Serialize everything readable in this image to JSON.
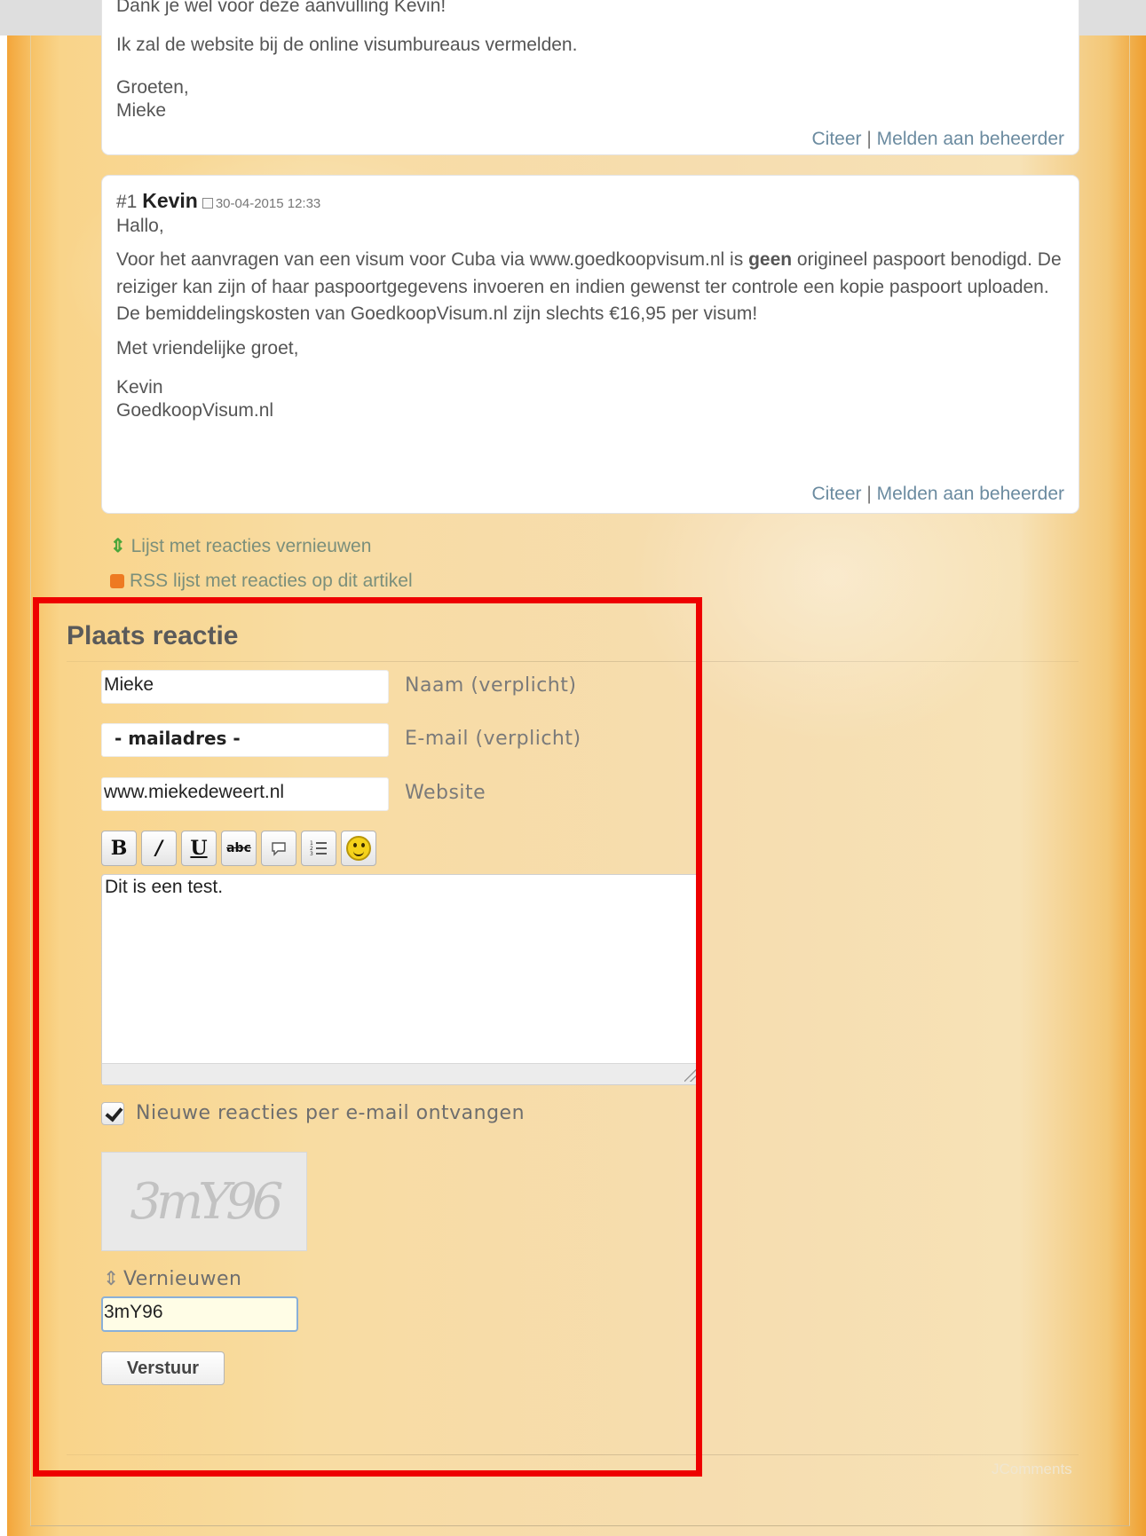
{
  "comments": [
    {
      "partial_text": "Dank je wel voor deze aanvulling Kevin!",
      "paragraph": "Ik zal de website bij de online visumbureaus vermelden.",
      "closing": "Groeten,",
      "author": "Mieke",
      "action_quote": "Citeer",
      "action_separator": "|",
      "action_report": "Melden aan beheerder"
    },
    {
      "number": "#1",
      "author": "Kevin",
      "date": "30-04-2015 12:33",
      "greeting": "Hallo,",
      "body_before_bold": "Voor het aanvragen van een visum voor Cuba via www.goedkoopvisum.nl is ",
      "body_bold": "geen",
      "body_after_bold": " origineel paspoort benodigd. De reiziger kan zijn of haar paspoortgegevens invoeren en indien gewenst ter controle een kopie paspoort uploaden. De bemiddelingskosten van GoedkoopVisum.nl zijn slechts €16,95 per visum!",
      "closing": "Met vriendelijke groet,",
      "signature_name": "Kevin",
      "signature_company": "GoedkoopVisum.nl",
      "action_quote": "Citeer",
      "action_separator": "|",
      "action_report": "Melden aan beheerder"
    }
  ],
  "links": {
    "refresh": "Lijst met reacties vernieuwen",
    "rss": "RSS lijst met reacties op dit artikel"
  },
  "form": {
    "title": "Plaats reactie",
    "name_value": "Mieke",
    "name_label": "Naam (verplicht)",
    "email_value": "- mailadres -",
    "email_label": "E-mail (verplicht)",
    "website_value": "www.miekedeweert.nl",
    "website_label": "Website",
    "toolbar": {
      "bold": "B",
      "italic": "I",
      "underline": "U",
      "strike": "abc",
      "quote_icon": "quote-icon",
      "list_icon": "list-icon",
      "smiley_icon": "smiley-icon"
    },
    "message": "Dit is een test.",
    "subscribe_checked": true,
    "subscribe_label": "Nieuwe reacties per e-mail ontvangen",
    "captcha_text": "3mY96",
    "refresh_captcha": "Vernieuwen",
    "captcha_value": "3mY96",
    "submit": "Verstuur"
  },
  "footer_brand": "JComments",
  "colors": {
    "highlight_box": "#ee0000",
    "link": "#6b8ba0",
    "background_orange": "#f3a53a"
  }
}
